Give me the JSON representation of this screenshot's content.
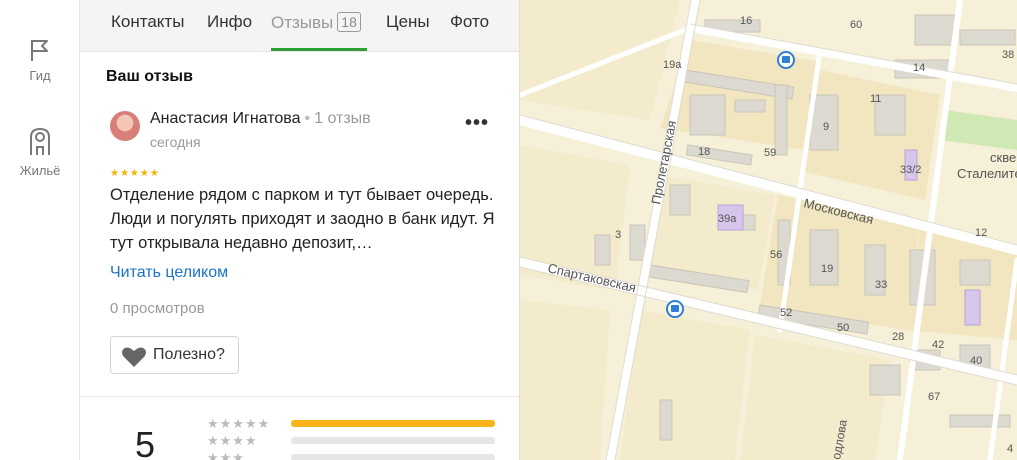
{
  "sidebar": {
    "items": [
      {
        "label": "Гид",
        "icon": "flag-icon"
      },
      {
        "label": "Жильё",
        "icon": "building-icon"
      }
    ]
  },
  "tabs": [
    {
      "label": "Контакты"
    },
    {
      "label": "Инфо"
    },
    {
      "label": "Отзывы",
      "badge": "18",
      "active": true
    },
    {
      "label": "Цены"
    },
    {
      "label": "Фото"
    }
  ],
  "review": {
    "section_title": "Ваш отзыв",
    "author": "Анастасия Игнатова",
    "author_separator": "•",
    "author_reviews": "1 отзыв",
    "date": "сегодня",
    "more_label": "•••",
    "rating": 5,
    "stars": "★★★★★",
    "text": "Отделение рядом с парком и тут бывает очередь. Люди и погулять приходят и заодно в банк идут. Я тут открывала недавно депозит,…",
    "read_more": "Читать целиком",
    "views": "0 просмотров",
    "helpful_label": "Полезно?"
  },
  "rating_summary": {
    "average": "5",
    "distribution": [
      {
        "stars": "★★★★★",
        "fraction": 1.0
      },
      {
        "stars": "★★★★",
        "fraction": 0.0
      },
      {
        "stars": "★★★",
        "fraction": 0.0
      }
    ]
  },
  "map": {
    "streets": [
      "Пролетарская",
      "Московская",
      "Спартаковская"
    ],
    "park_label_1": "сквер",
    "park_label_2": "Сталелитейщиков",
    "house_numbers": [
      "16",
      "60",
      "38",
      "19а",
      "14",
      "11",
      "9",
      "18",
      "59",
      "33/2",
      "39а",
      "12",
      "3",
      "56",
      "19",
      "33",
      "52",
      "50",
      "28",
      "42",
      "40",
      "67",
      "4"
    ],
    "partial_street": "одлова",
    "colors": {
      "land": "#f6f0d8",
      "block": "#f1e6bf",
      "building": "#dcd9d0",
      "road": "#ffffff",
      "accent_green": "#2ea036",
      "bus_stop": "#2f7fd7",
      "star": "#f5b400",
      "bar": "#f8b41a",
      "link": "#1a73c8"
    }
  }
}
